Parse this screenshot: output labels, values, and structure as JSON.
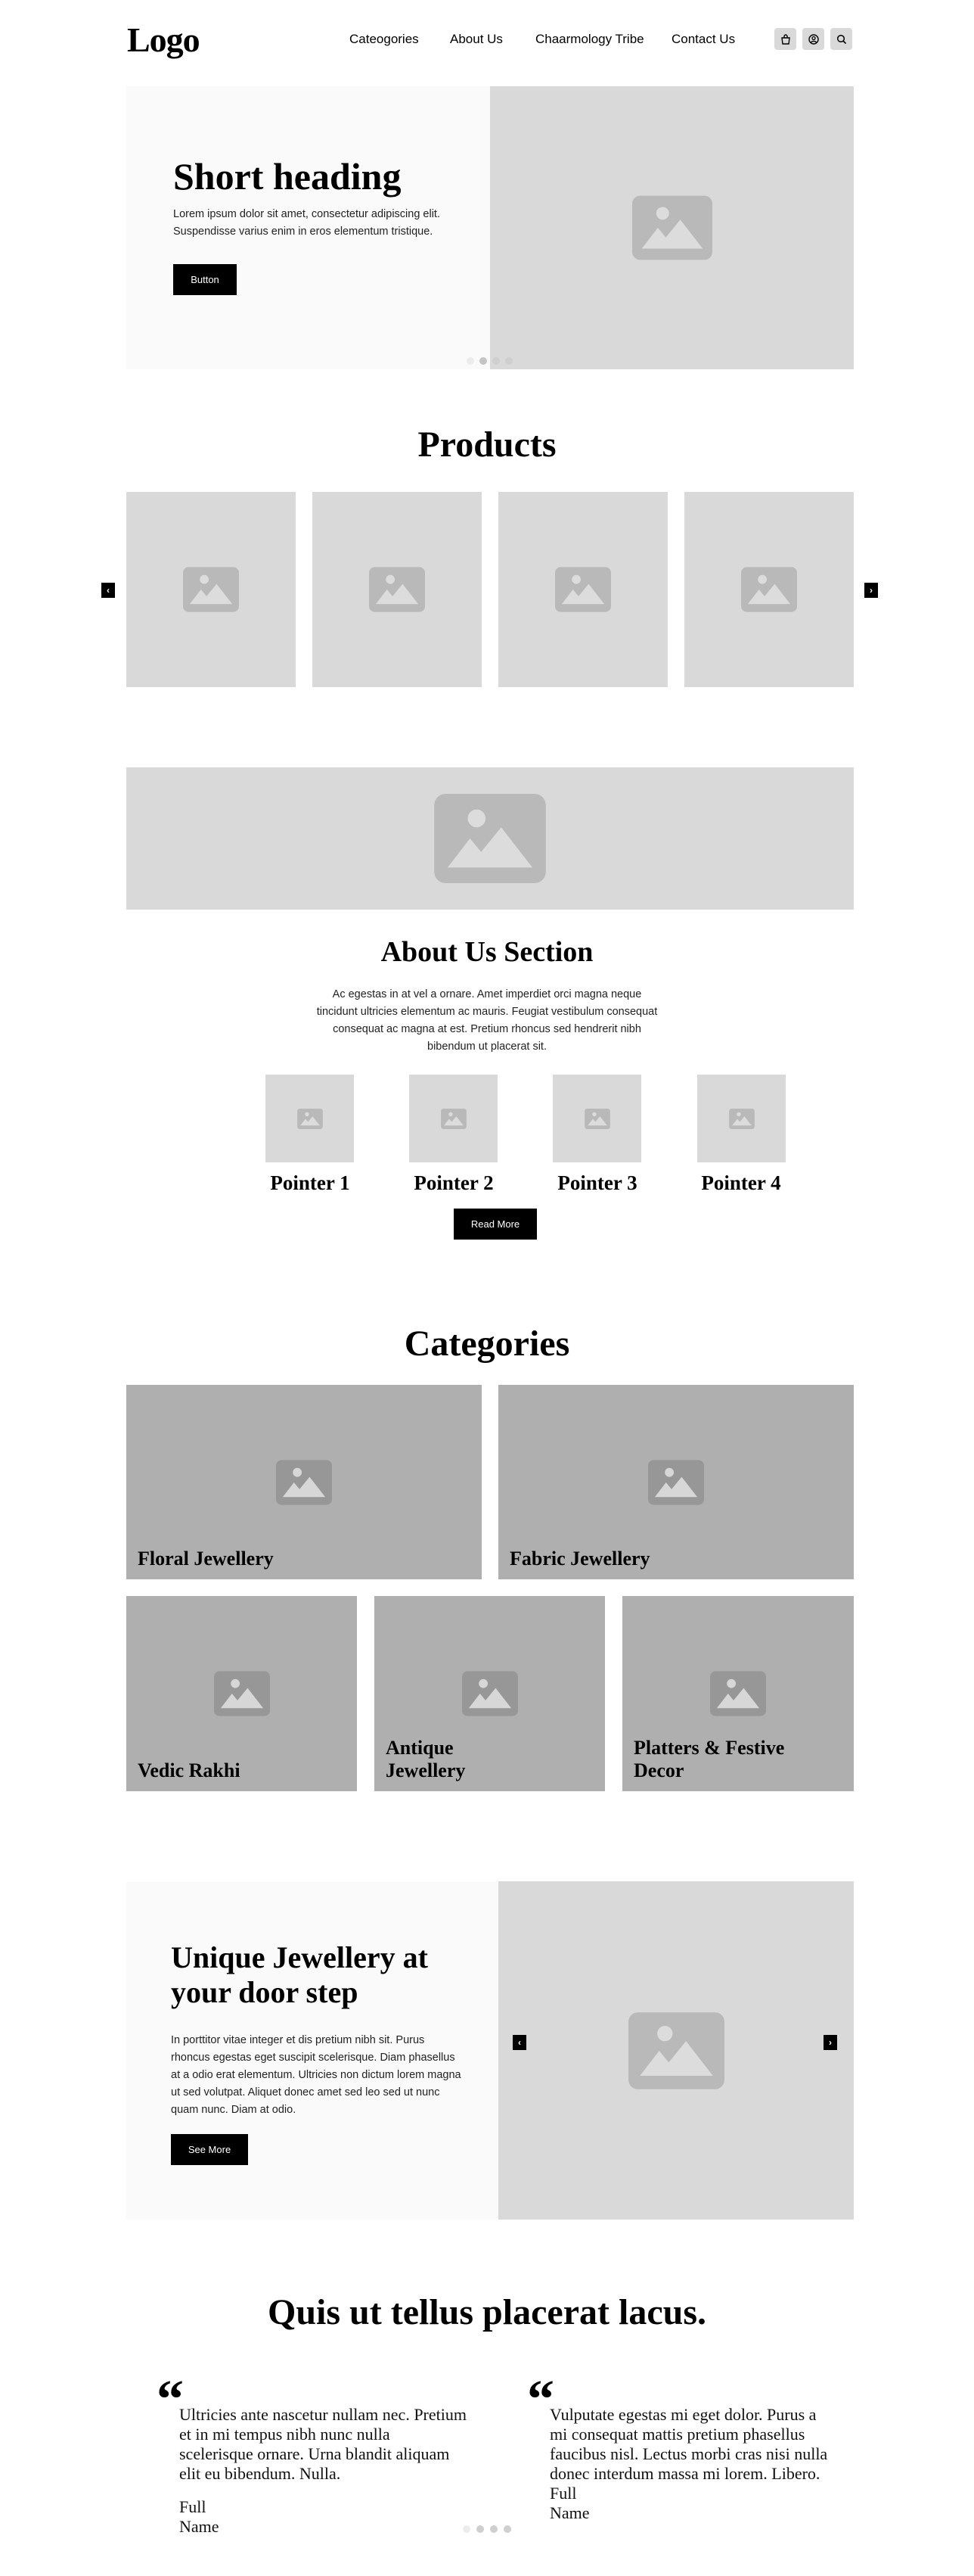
{
  "header": {
    "logo": "Logo",
    "nav": [
      "Cateogories",
      "About Us",
      "Chaarmology Tribe",
      "Contact Us"
    ],
    "icons": [
      "shopping-bag-icon",
      "account-icon",
      "search-icon"
    ]
  },
  "hero": {
    "title": "Short heading",
    "body": "Lorem ipsum dolor sit amet, consectetur adipiscing elit. Suspendisse varius enim in eros elementum tristique.",
    "button": "Button",
    "slide_count": 4,
    "active_slide": 2
  },
  "products": {
    "title": "Products",
    "count": 4,
    "prev_icon": "chevron-left-icon",
    "next_icon": "chevron-right-icon"
  },
  "about": {
    "title": "About Us Section",
    "body": "Ac egestas in at vel a ornare. Amet imperdiet orci magna neque tincidunt ultricies elementum ac mauris. Feugiat vestibulum consequat consequat ac magna at est. Pretium rhoncus sed hendrerit nibh bibendum ut placerat sit.",
    "pointers": [
      "Pointer 1",
      "Pointer 2",
      "Pointer 3",
      "Pointer 4"
    ],
    "button": "Read More"
  },
  "categories": {
    "title": "Categories",
    "items": [
      "Floral Jewellery",
      "Fabric Jewellery",
      "Vedic Rakhi",
      "Antique Jewellery",
      "Platters & Festive Decor"
    ]
  },
  "promo": {
    "title": "Unique Jewellery at your door step",
    "body": "In porttitor vitae integer et dis pretium nibh sit. Purus rhoncus egestas eget suscipit scelerisque. Diam phasellus at a odio erat elementum. Ultricies non dictum lorem magna ut sed volutpat. Aliquet donec amet sed leo sed ut nunc quam nunc. Diam at odio.",
    "button": "See More"
  },
  "testimonials": {
    "title": "Quis ut tellus placerat lacus.",
    "quote_glyph": "“",
    "items": [
      {
        "text": "Ultricies ante nascetur nullam nec. Pretium et in mi tempus nibh nunc nulla scelerisque ornare. Urna blandit aliquam elit eu bibendum. Nulla.",
        "name_first": "Full",
        "name_last": "Name"
      },
      {
        "text": "Vulputate egestas mi eget dolor. Purus a mi consequat mattis pretium phasellus faucibus nisl. Lectus morbi cras nisi nulla donec interdum massa mi lorem. Libero.",
        "name_first": "Full",
        "name_last": "Name"
      }
    ],
    "slide_count": 4,
    "active_slide": 1
  },
  "colors": {
    "placeholder_light": "#d9d9d9",
    "placeholder_dark": "#afafaf",
    "panel_bg": "#fafafa",
    "button_bg": "#000000",
    "button_text": "#ffffff"
  }
}
